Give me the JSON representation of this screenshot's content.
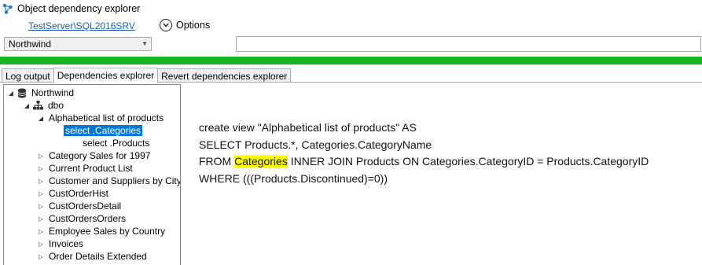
{
  "window": {
    "title": "Object dependency explorer"
  },
  "connection": {
    "server_link": "TestServer\\SQL2016SRV",
    "options_label": "Options"
  },
  "database_select": {
    "value": "Northwind"
  },
  "search": {
    "value": ""
  },
  "progress": {
    "value": 1.0,
    "color": "#16b51d"
  },
  "tabs": [
    {
      "label": "Log output",
      "active": false
    },
    {
      "label": "Dependencies explorer",
      "active": true
    },
    {
      "label": "Revert dependencies explorer",
      "active": false
    }
  ],
  "tree": {
    "root": "Northwind",
    "schema": "dbo",
    "expanded_object": "Alphabetical list of products",
    "children": [
      "select .Categories",
      "select .Products"
    ],
    "objects": [
      "Category Sales for 1997",
      "Current Product List",
      "Customer and Suppliers by City",
      "CustOrderHist",
      "CustOrdersDetail",
      "CustOrdersOrders",
      "Employee Sales by Country",
      "Invoices",
      "Order Details Extended"
    ]
  },
  "sql": {
    "line1": "create view \"Alphabetical list of products\" AS",
    "line2": "SELECT Products.*, Categories.CategoryName",
    "line3_pre": "FROM ",
    "line3_hl": "Categories",
    "line3_post": " INNER JOIN Products ON Categories.CategoryID = Products.CategoryID",
    "line4": "WHERE (((Products.Discontinued)=0))"
  },
  "icons": {
    "title": "dependency-graph-icon",
    "options": "chevron-down-circle-icon",
    "database": "database-icon",
    "schema": "schema-tree-icon"
  }
}
